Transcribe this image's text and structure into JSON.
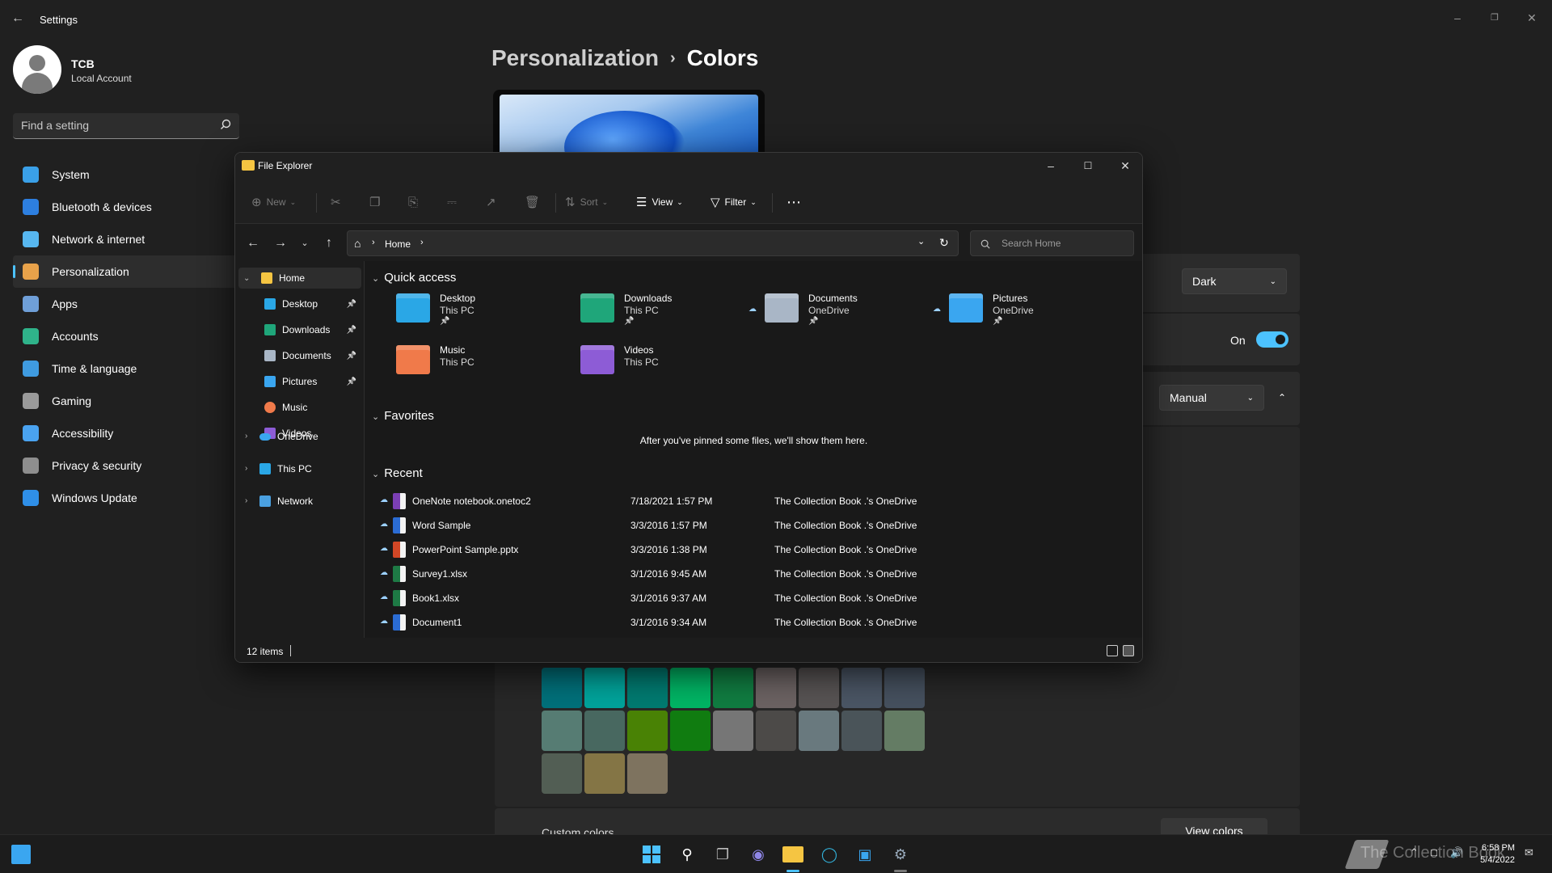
{
  "settings": {
    "window_title": "Settings",
    "profile": {
      "name": "TCB",
      "account_type": "Local Account"
    },
    "search_placeholder": "Find a setting",
    "nav": [
      {
        "label": "System",
        "icon": "display-icon",
        "color": "#3aa0e8"
      },
      {
        "label": "Bluetooth & devices",
        "icon": "bluetooth-icon",
        "color": "#2d7fe0"
      },
      {
        "label": "Network & internet",
        "icon": "wifi-icon",
        "color": "#57b7f0"
      },
      {
        "label": "Personalization",
        "icon": "brush-icon",
        "color": "#e8a24a"
      },
      {
        "label": "Apps",
        "icon": "apps-icon",
        "color": "#6f9fd8"
      },
      {
        "label": "Accounts",
        "icon": "person-icon",
        "color": "#2fb38a"
      },
      {
        "label": "Time & language",
        "icon": "globe-clock-icon",
        "color": "#3f9be0"
      },
      {
        "label": "Gaming",
        "icon": "gamepad-icon",
        "color": "#9a9a9a"
      },
      {
        "label": "Accessibility",
        "icon": "accessibility-icon",
        "color": "#4aa3f0"
      },
      {
        "label": "Privacy & security",
        "icon": "shield-icon",
        "color": "#8e8e8e"
      },
      {
        "label": "Windows Update",
        "icon": "update-icon",
        "color": "#2f8fe8"
      }
    ],
    "selected_nav": "Personalization",
    "breadcrumb": {
      "parent": "Personalization",
      "current": "Colors"
    },
    "mode_dropdown": "Dark",
    "transparency_toggle": "On",
    "accent_dropdown": "Manual",
    "custom_colors_label": "Custom colors",
    "view_colors_button": "View colors",
    "swatch_colors": [
      [
        "#00707a",
        "#00a39a",
        "#007a70",
        "#00b464",
        "#107c41",
        "#6b6262",
        "#575353",
        "#4a5564",
        "#45505e"
      ],
      [
        "#567c73",
        "#486860",
        "#498205",
        "#107c10",
        "#767676",
        "#4c4a48",
        "#69797e",
        "#4a5459",
        "#647c64"
      ],
      [
        "#525e54",
        "#847545",
        "#7e735f"
      ]
    ]
  },
  "explorer": {
    "title": "File Explorer",
    "commands": {
      "new": "New",
      "sort": "Sort",
      "view": "View",
      "filter": "Filter"
    },
    "address": {
      "crumb": "Home"
    },
    "search_placeholder": "Search Home",
    "tree": {
      "home": "Home",
      "pinned": [
        "Desktop",
        "Downloads",
        "Documents",
        "Pictures"
      ],
      "unpinned": [
        "Music",
        "Videos"
      ],
      "onedrive": "OneDrive",
      "thispc": "This PC",
      "network": "Network"
    },
    "sections": {
      "quick_access": "Quick access",
      "favorites": "Favorites",
      "recent": "Recent"
    },
    "quick_access": [
      {
        "name": "Desktop",
        "location": "This PC",
        "pinned": true,
        "cloud": false,
        "color": "#2aa7e6"
      },
      {
        "name": "Downloads",
        "location": "This PC",
        "pinned": true,
        "cloud": false,
        "color": "#1fa67a"
      },
      {
        "name": "Documents",
        "location": "OneDrive",
        "pinned": true,
        "cloud": true,
        "color": "#a9b6c6"
      },
      {
        "name": "Pictures",
        "location": "OneDrive",
        "pinned": true,
        "cloud": true,
        "color": "#3aa6f0"
      },
      {
        "name": "Music",
        "location": "This PC",
        "pinned": false,
        "cloud": false,
        "color": "#f07a4a"
      },
      {
        "name": "Videos",
        "location": "This PC",
        "pinned": false,
        "cloud": false,
        "color": "#8d5cd6"
      }
    ],
    "favorites_message": "After you've pinned some files, we'll show them here.",
    "recent": [
      {
        "name": "OneNote notebook.onetoc2",
        "date": "7/18/2021 1:57 PM",
        "location": "The Collection Book .'s OneDrive",
        "icon": "onenote-file-icon",
        "color": "#7b3fb5"
      },
      {
        "name": "Word Sample",
        "date": "3/3/2016 1:57 PM",
        "location": "The Collection Book .'s OneDrive",
        "icon": "word-file-icon",
        "color": "#2b6cd4"
      },
      {
        "name": "PowerPoint Sample.pptx",
        "date": "3/3/2016 1:38 PM",
        "location": "The Collection Book .'s OneDrive",
        "icon": "powerpoint-file-icon",
        "color": "#d24726"
      },
      {
        "name": "Survey1.xlsx",
        "date": "3/1/2016 9:45 AM",
        "location": "The Collection Book .'s OneDrive",
        "icon": "excel-file-icon",
        "color": "#1e7a45"
      },
      {
        "name": "Book1.xlsx",
        "date": "3/1/2016 9:37 AM",
        "location": "The Collection Book .'s OneDrive",
        "icon": "excel-file-icon",
        "color": "#1e7a45"
      },
      {
        "name": "Document1",
        "date": "3/1/2016 9:34 AM",
        "location": "The Collection Book .'s OneDrive",
        "icon": "word-file-icon",
        "color": "#2b6cd4"
      }
    ],
    "status": {
      "item_count": "12 items"
    }
  },
  "taskbar": {
    "clock_time": "6:58 PM",
    "clock_date": "5/4/2022",
    "watermark": "The Collection Book"
  },
  "accent_color": "#4cc2ff"
}
